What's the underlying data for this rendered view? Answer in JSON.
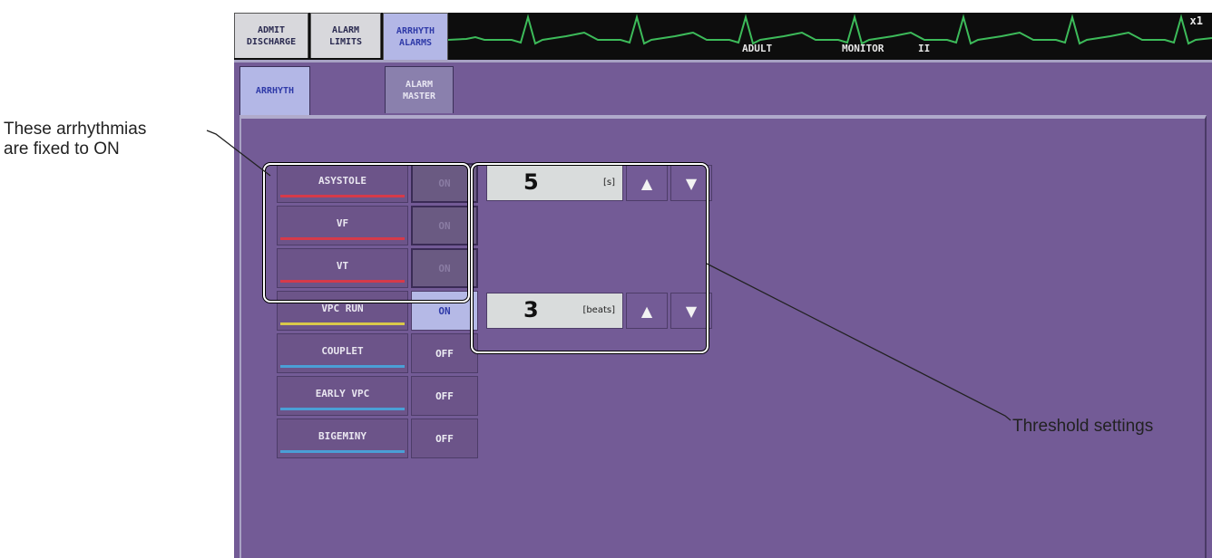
{
  "tabs": [
    {
      "label": "ADMIT\nDISCHARGE",
      "active": false
    },
    {
      "label": "ALARM\nLIMITS",
      "active": false
    },
    {
      "label": "ARRHYTH\nALARMS",
      "active": true
    }
  ],
  "status": {
    "patient_type": "ADULT",
    "mode": "MONITOR",
    "lead": "II",
    "scale": "x1"
  },
  "subtabs": [
    {
      "label": "ARRHYTH",
      "active": true
    },
    {
      "label": "ALARM\nMASTER",
      "active": false
    }
  ],
  "arrhythmias": [
    {
      "name": "ASYSTOLE",
      "state": "ON",
      "fixed": true,
      "color": "#d63a4a"
    },
    {
      "name": "VF",
      "state": "ON",
      "fixed": true,
      "color": "#d63a4a"
    },
    {
      "name": "VT",
      "state": "ON",
      "fixed": true,
      "color": "#d63a4a"
    },
    {
      "name": "VPC RUN",
      "state": "ON",
      "fixed": false,
      "color": "#d9c84a"
    },
    {
      "name": "COUPLET",
      "state": "OFF",
      "fixed": false,
      "color": "#4a9fd6"
    },
    {
      "name": "EARLY VPC",
      "state": "OFF",
      "fixed": false,
      "color": "#4a9fd6"
    },
    {
      "name": "BIGEMINY",
      "state": "OFF",
      "fixed": false,
      "color": "#4a9fd6"
    }
  ],
  "thresholds": {
    "asystole": {
      "value": "5",
      "unit": "[s]"
    },
    "vpc_run": {
      "value": "3",
      "unit": "[beats]"
    }
  },
  "icons": {
    "up": "▲",
    "down": "▼"
  },
  "annotations": {
    "fixed_on": "These arrhythmias\nare fixed to ON",
    "threshold": "Threshold settings"
  },
  "colors": {
    "panel": "#735b96",
    "ecg": "#3dbb5a",
    "active_tab": "#b3b7e6"
  }
}
